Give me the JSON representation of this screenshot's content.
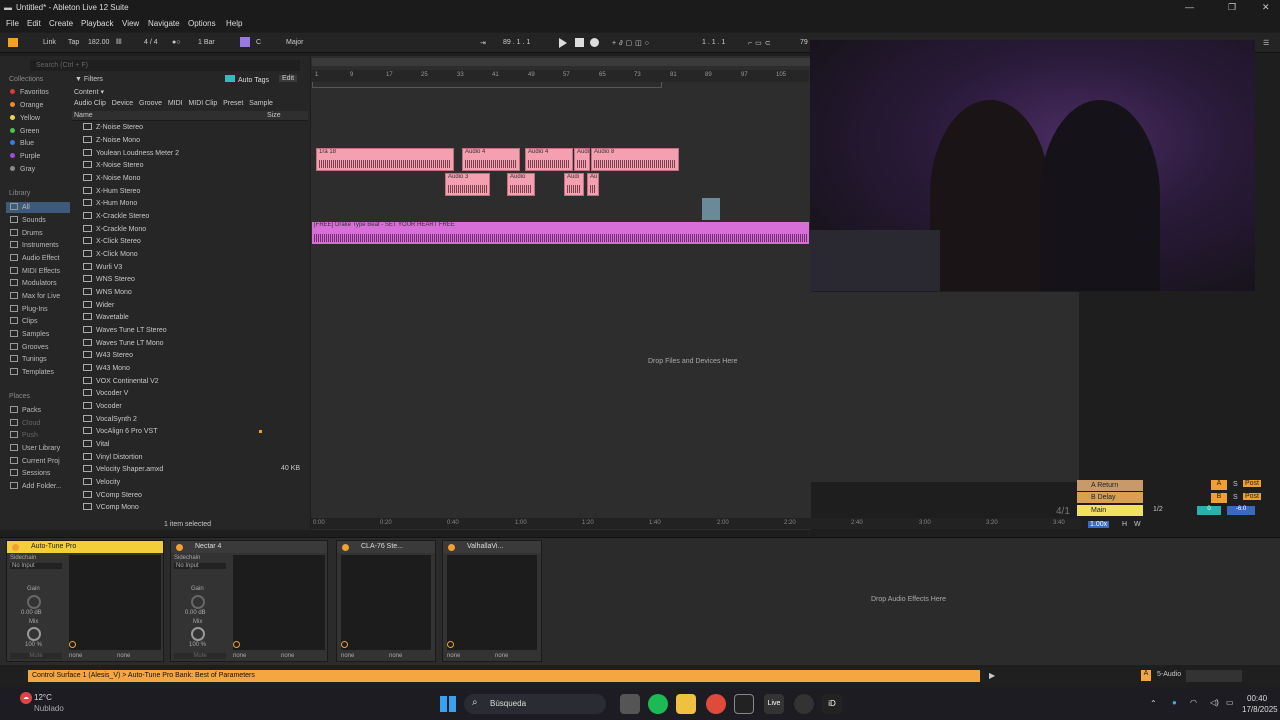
{
  "window": {
    "title": "Untitled* - Ableton Live 12 Suite",
    "minimize": "—",
    "maximize": "❐",
    "close": "✕"
  },
  "menu": [
    "File",
    "Edit",
    "Create",
    "Playback",
    "View",
    "Navigate",
    "Options",
    "Help"
  ],
  "transport": {
    "link": "Link",
    "tap": "Tap",
    "tempo": "182.00",
    "meter": "4 / 4",
    "quantize": "1 Bar",
    "key": "C",
    "scale": "Major",
    "position": "89 . 1 . 1",
    "loop_start": "1 . 1 . 1",
    "loop_len": "79"
  },
  "browser": {
    "search_placeholder": "Search (Ctrl + F)",
    "filters_label": "Filters",
    "auto_tags": "Auto Tags",
    "edit": "Edit",
    "content": "Content",
    "tabs": [
      "Audio Clip",
      "Device",
      "Groove",
      "MIDI",
      "MIDI Clip",
      "Preset",
      "Sample"
    ],
    "col_name": "Name",
    "col_size": "Size",
    "collections_head": "Collections",
    "collections": [
      {
        "label": "Favoritos",
        "color": "#e03a3a"
      },
      {
        "label": "Orange",
        "color": "#f08a2a"
      },
      {
        "label": "Yellow",
        "color": "#e8d84a"
      },
      {
        "label": "Green",
        "color": "#4ac44a"
      },
      {
        "label": "Blue",
        "color": "#3a7ae0"
      },
      {
        "label": "Purple",
        "color": "#a04ad8"
      },
      {
        "label": "Gray",
        "color": "#8a8a8a"
      }
    ],
    "library_head": "Library",
    "library": [
      "All",
      "Sounds",
      "Drums",
      "Instruments",
      "Audio Effect",
      "MIDI Effects",
      "Modulators",
      "Max for Live",
      "Plug-Ins",
      "Clips",
      "Samples",
      "Grooves",
      "Tunings",
      "Templates"
    ],
    "places_head": "Places",
    "places": [
      "Packs",
      "Cloud",
      "Push",
      "User Library",
      "Current Proj",
      "Sessions",
      "Add Folder..."
    ],
    "files": [
      "Z-Noise Stereo",
      "Z-Noise Mono",
      "Youlean Loudness Meter 2",
      "X-Noise Stereo",
      "X-Noise Mono",
      "X-Hum Stereo",
      "X-Hum Mono",
      "X-Crackle Stereo",
      "X-Crackle Mono",
      "X-Click Stereo",
      "X-Click Mono",
      "Wurli V3",
      "WNS Stereo",
      "WNS Mono",
      "Wider",
      "Wavetable",
      "Waves Tune LT Stereo",
      "Waves Tune LT Mono",
      "W43 Stereo",
      "W43 Mono",
      "VOX Continental V2",
      "Vocoder V",
      "Vocoder",
      "VocalSynth 2",
      "VocAlign 6 Pro VST",
      "Vital",
      "Vinyl Distortion",
      "Velocity Shaper.amxd",
      "Velocity",
      "VComp Stereo",
      "VComp Mono"
    ],
    "file_size_velocity_shaper": "40 KB",
    "selection_status": "1 item selected"
  },
  "arrangement": {
    "ruler": [
      "1",
      "9",
      "17",
      "25",
      "33",
      "41",
      "49",
      "57",
      "65",
      "73",
      "81",
      "89",
      "97",
      "105"
    ],
    "clips_row1": [
      "1ra 18",
      "Audio 4",
      "Audio 4",
      "Audi",
      "Audio 8"
    ],
    "clips_row2": [
      "Audio 3",
      "Audio",
      "Audi",
      "Au"
    ],
    "drake_clip": "[FREE] Drake Type Beat - SET YOUR HEART FREE",
    "drop_files": "Drop Files and Devices Here",
    "time_ruler": [
      "0:00",
      "0:20",
      "0:40",
      "1:00",
      "1:20",
      "1:40",
      "2:00",
      "2:20",
      "2:40",
      "3:00",
      "3:20",
      "3:40"
    ],
    "meter_display": "4/1"
  },
  "returns": {
    "a": "A Return",
    "b": "B Delay",
    "main": "Main",
    "a_letter": "A",
    "b_letter": "B",
    "solo": "S",
    "post": "Post",
    "main_ratio": "1/2",
    "main_val": "0",
    "main_db": "-6.0",
    "zoom": "1.00x",
    "h": "H",
    "w": "W"
  },
  "devices": [
    {
      "name": "Auto-Tune Pro",
      "sidechain": "Sidechain",
      "input": "No Input",
      "gain": "Gain",
      "gain_val": "0.00 dB",
      "mix": "Mix",
      "mix_val": "100 %",
      "mute": "Mute",
      "s1": "none",
      "s2": "none"
    },
    {
      "name": "Nectar 4",
      "sidechain": "Sidechain",
      "input": "No Input",
      "gain": "Gain",
      "gain_val": "0.00 dB",
      "mix": "Mix",
      "mix_val": "100 %",
      "mute": "Mute",
      "s1": "none",
      "s2": "none"
    },
    {
      "name": "CLA-76 Ste...",
      "s1": "none",
      "s2": "none"
    },
    {
      "name": "ValhallaVi...",
      "s1": "none",
      "s2": "none"
    }
  ],
  "drop_audio_effects": "Drop Audio Effects Here",
  "status": {
    "message": "Control Surface 1 (Alesis_V) > Auto-Tune Pro Bank: Best of Parameters",
    "track": "5-Audio"
  },
  "taskbar": {
    "temp": "12°C",
    "weather": "Nublado",
    "search": "Búsqueda",
    "time": "00:40",
    "date": "17/8/2025"
  }
}
